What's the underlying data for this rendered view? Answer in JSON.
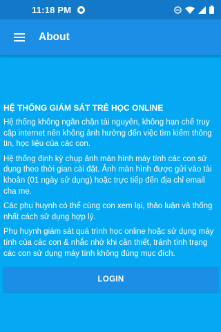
{
  "status_bar": {
    "time": "11:18 PM",
    "icons": [
      "notification-icon",
      "do-not-disturb-icon",
      "wifi-icon",
      "cellular-signal-icon",
      "battery-icon"
    ]
  },
  "app_bar": {
    "title": "About",
    "menu_icon": "hamburger-menu-icon"
  },
  "content": {
    "heading": "HỆ THỐNG GIÁM SÁT TRẺ HỌC ONLINE",
    "paragraphs": [
      "Hệ thống không ngăn chặn tài nguyên, không hạn chế truy cập internet nên không ảnh hưởng đến việc tìm kiếm thông tin, học liệu của các con.",
      "Hệ thống định kỳ chụp ảnh màn hình máy tính các con sử dụng theo thời gian cài đặt. Ảnh màn hình được gửi vào tài khoản (01 ngày sử dụng) hoặc trực tiếp đến địa chỉ email cha mẹ.",
      "Các phụ huynh có thể cùng con xem lại, thảo luận và thống nhất cách sử dụng hợp lý.",
      "Phụ huynh giám sát quá trình học online hoặc sử dụng máy tính của các con & nhắc nhở khi cần thiết, tránh tình trạng các con sử dụng máy tính không đúng mục đích."
    ]
  },
  "login_button": {
    "label": "LOGIN"
  },
  "colors": {
    "background": "#05a8f2",
    "status_bar": "#1478c9",
    "app_bar": "#1d8ee6",
    "button": "#1d8ee6",
    "text": "#ffffff"
  }
}
